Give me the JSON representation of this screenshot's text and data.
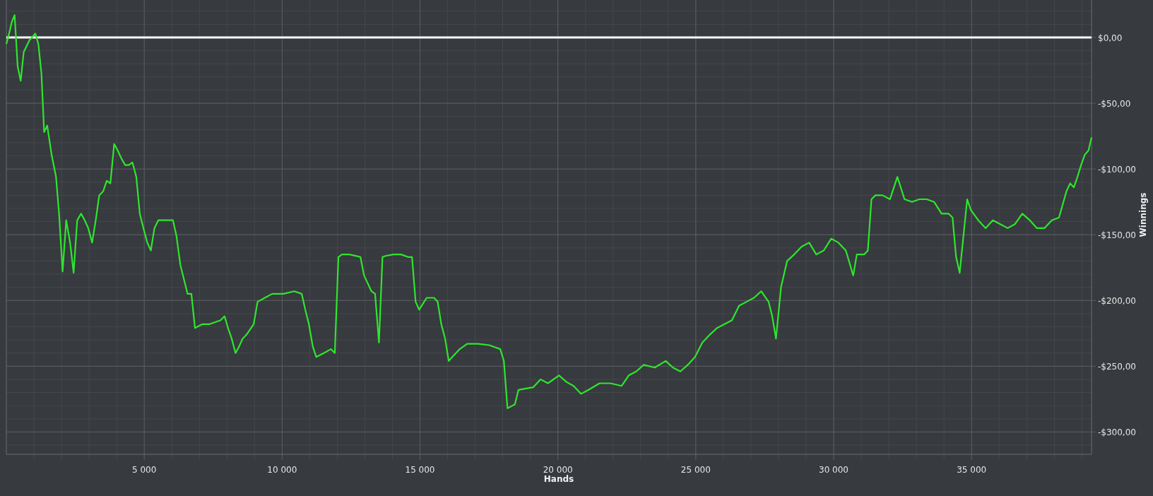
{
  "chart_data": {
    "type": "line",
    "xlabel": "Hands",
    "ylabel": "Winnings",
    "xlim": [
      0,
      39350
    ],
    "ylim": [
      -317,
      28.5
    ],
    "xticks": [
      {
        "value": 5000,
        "label": "5 000"
      },
      {
        "value": 10000,
        "label": "10 000"
      },
      {
        "value": 15000,
        "label": "15 000"
      },
      {
        "value": 20000,
        "label": "20 000"
      },
      {
        "value": 25000,
        "label": "25 000"
      },
      {
        "value": 30000,
        "label": "30 000"
      },
      {
        "value": 35000,
        "label": "35 000"
      }
    ],
    "yticks": [
      {
        "value": 0,
        "label": "$0,00"
      },
      {
        "value": -50,
        "label": "-$50,00"
      },
      {
        "value": -100,
        "label": "-$100,00"
      },
      {
        "value": -150,
        "label": "-$150,00"
      },
      {
        "value": -200,
        "label": "-$200,00"
      },
      {
        "value": -250,
        "label": "-$250,00"
      },
      {
        "value": -300,
        "label": "-$300,00"
      }
    ],
    "ref_lines": [
      {
        "axis": "y",
        "value": 0,
        "color": "#ffffff"
      }
    ],
    "grid": true,
    "x": [
      0,
      100,
      200,
      300,
      410,
      520,
      630,
      840,
      1050,
      1160,
      1270,
      1370,
      1480,
      1640,
      1800,
      1910,
      2040,
      2170,
      2310,
      2440,
      2570,
      2710,
      2840,
      2970,
      3110,
      3240,
      3370,
      3510,
      3640,
      3770,
      3910,
      4040,
      4170,
      4310,
      4440,
      4570,
      4710,
      4840,
      4970,
      5110,
      5240,
      5370,
      5510,
      5770,
      6040,
      6170,
      6310,
      6440,
      6570,
      6710,
      6840,
      7110,
      7370,
      7770,
      7910,
      8040,
      8170,
      8310,
      8440,
      8570,
      8710,
      8970,
      9110,
      9370,
      9640,
      10040,
      10440,
      10710,
      10840,
      10970,
      11110,
      11240,
      11510,
      11770,
      11910,
      12040,
      12170,
      12440,
      12840,
      12970,
      13240,
      13370,
      13510,
      13640,
      13770,
      14040,
      14310,
      14570,
      14710,
      14840,
      14970,
      15240,
      15510,
      15640,
      15770,
      15910,
      16040,
      16170,
      16440,
      16710,
      17110,
      17510,
      17910,
      18040,
      18170,
      18440,
      18570,
      18840,
      19110,
      19370,
      19640,
      20040,
      20310,
      20570,
      20840,
      21110,
      21510,
      21910,
      22310,
      22570,
      22840,
      23110,
      23510,
      23910,
      24170,
      24440,
      24710,
      24970,
      25240,
      25510,
      25770,
      26040,
      26310,
      26570,
      26840,
      27110,
      27370,
      27640,
      27770,
      27910,
      28090,
      28310,
      28570,
      28840,
      29110,
      29370,
      29640,
      29910,
      30170,
      30440,
      30710,
      30840,
      31110,
      31240,
      31370,
      31510,
      31770,
      32040,
      32310,
      32570,
      32840,
      33110,
      33370,
      33640,
      33910,
      34170,
      34310,
      34440,
      34570,
      34840,
      34970,
      35240,
      35510,
      35770,
      36040,
      36310,
      36570,
      36840,
      37110,
      37370,
      37640,
      37910,
      38170,
      38440,
      38570,
      38710,
      38840,
      38970,
      39110,
      39240,
      39350
    ],
    "series": [
      {
        "color": "#2ee62e",
        "values": [
          -5,
          3,
          12,
          17,
          -22,
          -33,
          -11,
          -2,
          3,
          -5,
          -27,
          -72,
          -67,
          -89,
          -106,
          -134,
          -178,
          -139,
          -156,
          -179,
          -139,
          -134,
          -139,
          -145,
          -156,
          -139,
          -120,
          -117,
          -109,
          -111,
          -81,
          -86,
          -92,
          -97,
          -97,
          -95,
          -106,
          -134,
          -145,
          -156,
          -162,
          -145,
          -139,
          -139,
          -139,
          -151,
          -173,
          -184,
          -195,
          -195,
          -221,
          -218,
          -218,
          -215,
          -212,
          -221,
          -229,
          -240,
          -235,
          -229,
          -226,
          -218,
          -201,
          -198,
          -195,
          -195,
          -193,
          -195,
          -207,
          -218,
          -235,
          -243,
          -240,
          -237,
          -240,
          -167,
          -165,
          -165,
          -167,
          -181,
          -193,
          -195,
          -232,
          -167,
          -166,
          -165,
          -165,
          -167,
          -167,
          -201,
          -207,
          -198,
          -198,
          -201,
          -218,
          -229,
          -246,
          -243,
          -237,
          -233,
          -233,
          -234,
          -237,
          -246,
          -282,
          -279,
          -268,
          -267,
          -266,
          -260,
          -263,
          -257,
          -262,
          -265,
          -271,
          -268,
          -263,
          -263,
          -265,
          -257,
          -254,
          -249,
          -251,
          -246,
          -251,
          -254,
          -249,
          -243,
          -232,
          -226,
          -221,
          -218,
          -215,
          -204,
          -201,
          -198,
          -193,
          -201,
          -212,
          -229,
          -190,
          -170,
          -165,
          -159,
          -156,
          -165,
          -162,
          -153,
          -156,
          -162,
          -181,
          -165,
          -165,
          -162,
          -123,
          -120,
          -120,
          -123,
          -106,
          -123,
          -125,
          -123,
          -123,
          -125,
          -134,
          -134,
          -137,
          -167,
          -179,
          -123,
          -131,
          -139,
          -145,
          -139,
          -142,
          -145,
          -142,
          -134,
          -139,
          -145,
          -145,
          -139,
          -137,
          -117,
          -111,
          -114,
          -106,
          -97,
          -89,
          -86,
          -76
        ]
      }
    ]
  }
}
